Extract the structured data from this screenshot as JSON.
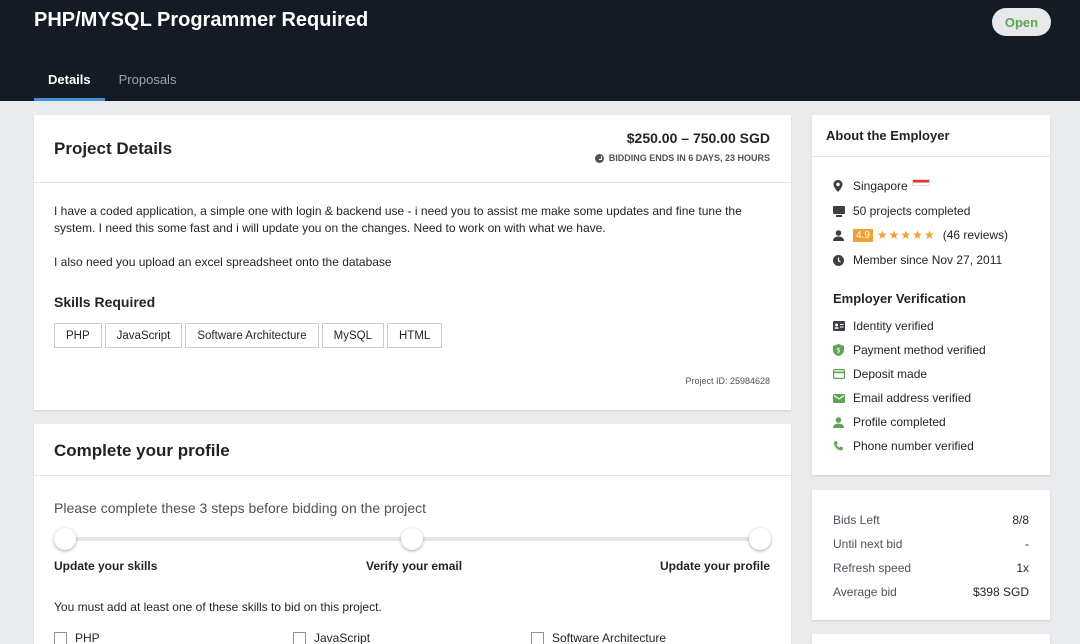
{
  "header": {
    "title": "PHP/MYSQL Programmer Required",
    "status": "Open",
    "tabs": [
      {
        "label": "Details",
        "active": true
      },
      {
        "label": "Proposals",
        "active": false
      }
    ]
  },
  "project_details": {
    "title": "Project Details",
    "budget": "$250.00 – 750.00 SGD",
    "bidding_ends": "BIDDING ENDS IN 6 DAYS, 23 HOURS",
    "description": "I have a coded application, a simple one with login & backend use - i need you to assist me make some updates and fine tune the system. I need this some fast and i will update you on the changes. Need to work on with what we have.",
    "description2": "I also need you upload an excel spreadsheet onto the database",
    "skills_title": "Skills Required",
    "skills": [
      "PHP",
      "JavaScript",
      "Software Architecture",
      "MySQL",
      "HTML"
    ],
    "project_id": "Project ID: 25984628"
  },
  "complete_profile": {
    "title": "Complete your profile",
    "intro": "Please complete these 3 steps before bidding on the project",
    "steps": [
      "Update your skills",
      "Verify your email",
      "Update your profile"
    ],
    "must_add": "You must add at least one of these skills to bid on this project.",
    "skill_options": [
      "PHP",
      "JavaScript",
      "Software Architecture"
    ]
  },
  "employer": {
    "title": "About the Employer",
    "location": "Singapore",
    "projects": "50 projects completed",
    "rating": "4.9",
    "stars": "★★★★★",
    "reviews": "(46 reviews)",
    "member_since": "Member since Nov 27, 2011",
    "verification_title": "Employer Verification",
    "verifications": [
      {
        "label": "Identity verified",
        "icon": "id-card-icon"
      },
      {
        "label": "Payment method verified",
        "icon": "shield-dollar-icon"
      },
      {
        "label": "Deposit made",
        "icon": "credit-card-icon"
      },
      {
        "label": "Email address verified",
        "icon": "envelope-icon"
      },
      {
        "label": "Profile completed",
        "icon": "person-icon"
      },
      {
        "label": "Phone number verified",
        "icon": "phone-icon"
      }
    ],
    "colors": {
      "verified": "#5da552",
      "rating": "#f1a032"
    }
  },
  "bids": {
    "rows": [
      {
        "key": "Bids Left",
        "value": "8/8"
      },
      {
        "key": "Until next bid",
        "value": "-"
      },
      {
        "key": "Refresh speed",
        "value": "1x"
      },
      {
        "key": "Average bid",
        "value": "$398 SGD"
      }
    ]
  }
}
